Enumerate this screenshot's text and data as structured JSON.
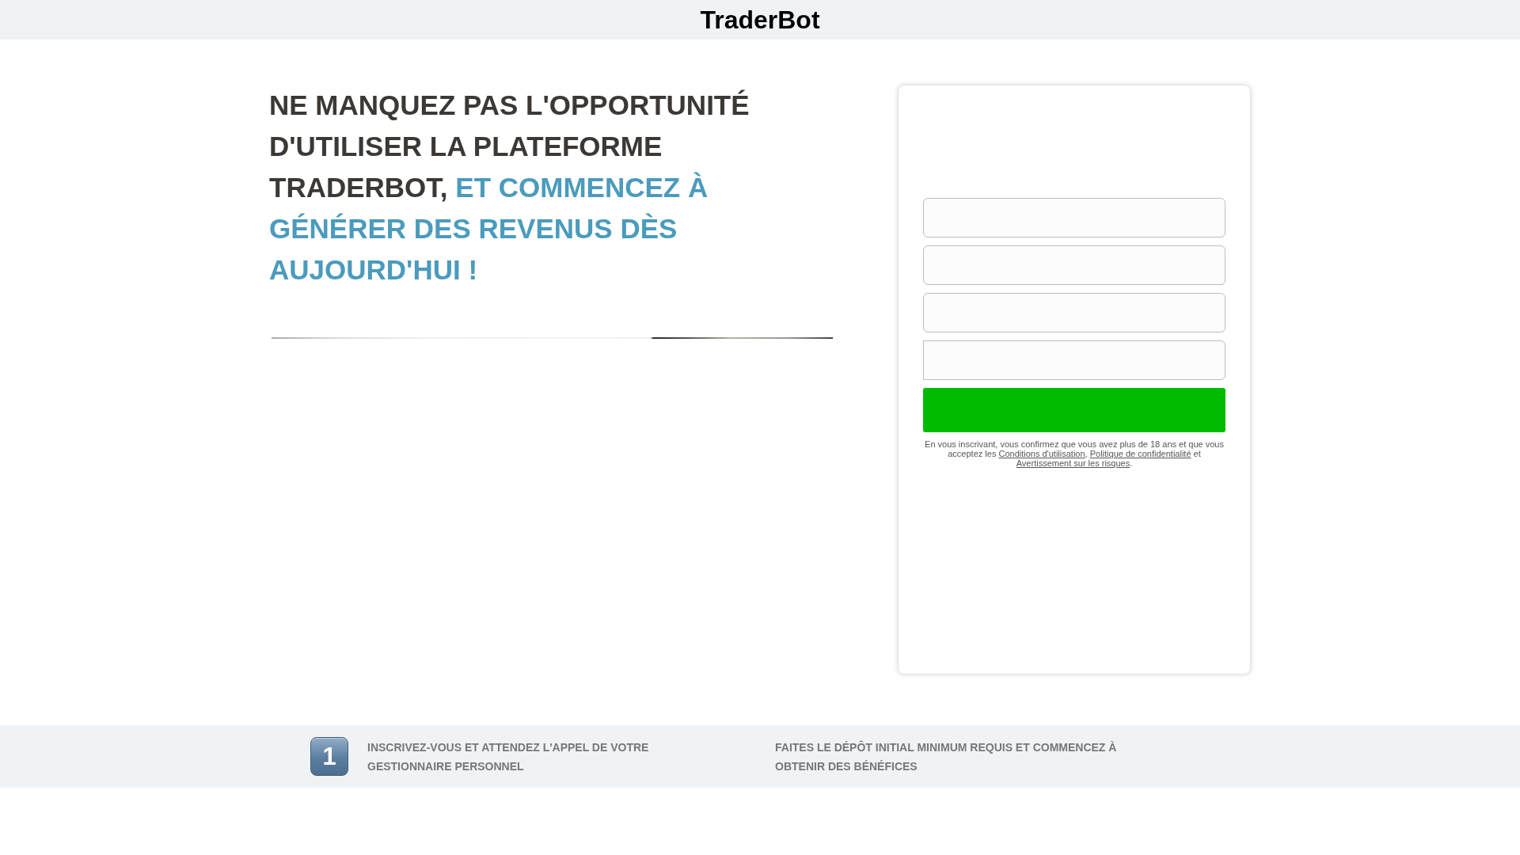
{
  "header": {
    "title": "TraderBot"
  },
  "hero": {
    "headline": [
      {
        "text": "NE MANQUEZ PAS L'OPPORTUNITÉ D'UTILISER LA PLATEFORME TRADERBOT,",
        "highlighted": false
      },
      {
        "text": "ET COMMENCEZ À GÉNÉRER DES REVENUS DÈS AUJOURD'HUI !",
        "highlighted": true
      }
    ]
  },
  "form": {
    "controls": [
      {
        "kind": "text"
      },
      {
        "kind": "text"
      },
      {
        "kind": "text"
      },
      {
        "kind": "phone"
      },
      {
        "kind": "submit"
      }
    ],
    "disclaimer": [
      {
        "kind": "text",
        "text": "En vous inscrivant, vous confirmez que vous avez plus de 18 ans et que vous acceptez les "
      },
      {
        "kind": "link",
        "text": "Conditions d'utilisation"
      },
      {
        "kind": "text",
        "text": ", "
      },
      {
        "kind": "link",
        "text": "Politique de confidentialité"
      },
      {
        "kind": "text",
        "text": " et "
      },
      {
        "kind": "link",
        "text": "Avertissement sur les risques"
      },
      {
        "kind": "text",
        "text": "."
      }
    ]
  },
  "steps": [
    {
      "number": "1",
      "text": "INSCRIVEZ-VOUS ET ATTENDEZ L'APPEL DE VOTRE GESTIONNAIRE PERSONNEL"
    },
    {
      "text": "FAITES LE DÉPÔT INITIAL MINIMUM REQUIS ET COMMENCEZ À OBTENIR DES BÉNÉFICES"
    }
  ]
}
